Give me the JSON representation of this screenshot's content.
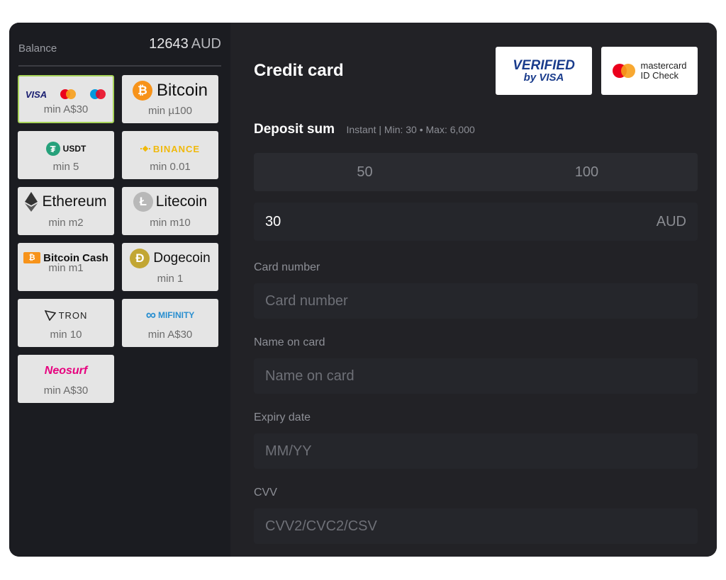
{
  "sidebar": {
    "balance_label": "Balance",
    "balance_value": "12643",
    "balance_currency": "AUD",
    "methods": [
      {
        "name": "VISA",
        "min": "min A$30"
      },
      {
        "name": "Bitcoin",
        "min": "min µ100"
      },
      {
        "name": "USDT",
        "min": "min 5"
      },
      {
        "name": "BINANCE",
        "min": "min 0.01"
      },
      {
        "name": "Ethereum",
        "min": "min m2"
      },
      {
        "name": "Litecoin",
        "min": "min m10"
      },
      {
        "name": "Bitcoin Cash",
        "min": "min m1"
      },
      {
        "name": "Dogecoin",
        "min": "min 1"
      },
      {
        "name": "TRON",
        "min": "min 10"
      },
      {
        "name": "MIFINITY",
        "min": "min A$30"
      },
      {
        "name": "Neosurf",
        "min": "min A$30"
      }
    ]
  },
  "main": {
    "title": "Credit card",
    "badges": {
      "verified_line1": "VERIFIED",
      "verified_line2": "by VISA",
      "mc_line1": "mastercard",
      "mc_line2": "ID Check"
    },
    "deposit": {
      "title": "Deposit sum",
      "info": "Instant | Min: 30 • Max: 6,000",
      "presets": [
        "50",
        "100"
      ],
      "amount": "30",
      "currency": "AUD"
    },
    "fields": {
      "card_number_label": "Card number",
      "card_number_placeholder": "Card number",
      "name_label": "Name on card",
      "name_placeholder": "Name on card",
      "expiry_label": "Expiry date",
      "expiry_placeholder": "MM/YY",
      "cvv_label": "CVV",
      "cvv_placeholder": "CVV2/CVC2/CSV"
    }
  },
  "colors": {
    "selected_border": "#a8d45a",
    "bitcoin": "#f7931a",
    "usdt": "#26a17b",
    "dogecoin": "#c2a633",
    "neosurf": "#e6007e",
    "mifinity": "#2a8fd0",
    "binance": "#f0b90b"
  }
}
